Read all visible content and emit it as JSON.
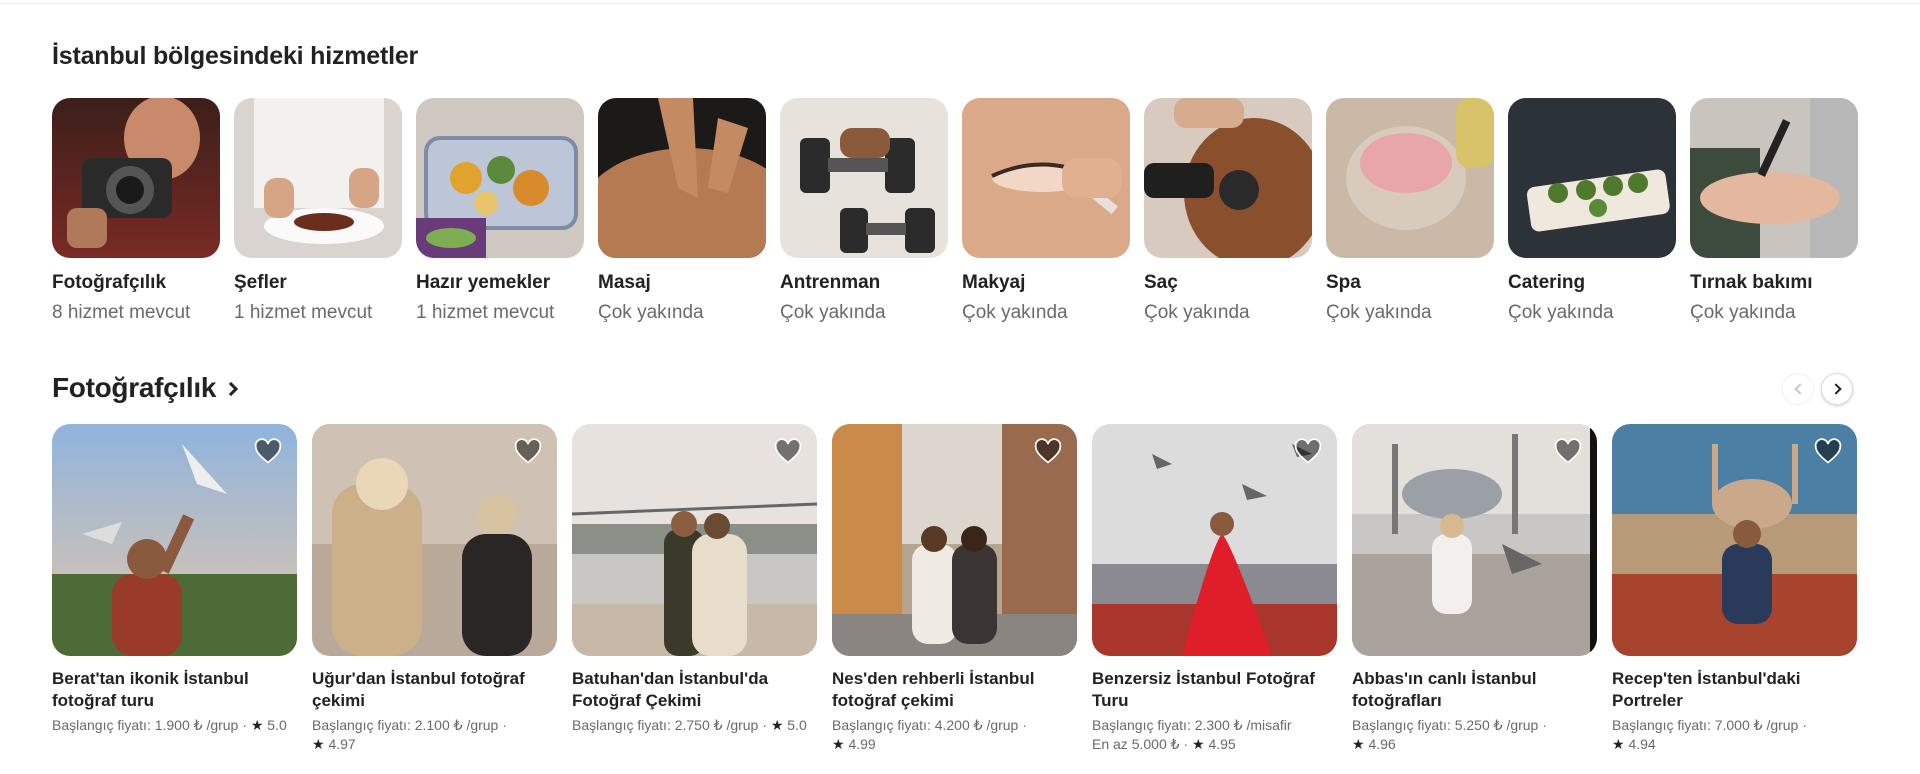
{
  "services": {
    "title": "İstanbul bölgesindeki hizmetler",
    "categories": [
      {
        "name": "Fotoğrafçılık",
        "sub": "8 hizmet mevcut"
      },
      {
        "name": "Şefler",
        "sub": "1 hizmet mevcut"
      },
      {
        "name": "Hazır yemekler",
        "sub": "1 hizmet mevcut"
      },
      {
        "name": "Masaj",
        "sub": "Çok yakında"
      },
      {
        "name": "Antrenman",
        "sub": "Çok yakında"
      },
      {
        "name": "Makyaj",
        "sub": "Çok yakında"
      },
      {
        "name": "Saç",
        "sub": "Çok yakında"
      },
      {
        "name": "Spa",
        "sub": "Çok yakında"
      },
      {
        "name": "Catering",
        "sub": "Çok yakında"
      },
      {
        "name": "Tırnak bakımı",
        "sub": "Çok yakında"
      }
    ]
  },
  "photography": {
    "title": "Fotoğrafçılık",
    "listings": [
      {
        "title": "Berat'tan ikonik İstanbul fotoğraf turu",
        "price": "Başlangıç fiyatı: 1.900 ₺ /grup",
        "extra": "",
        "rating": "5.0"
      },
      {
        "title": "Uğur'dan İstanbul fotoğraf çekimi",
        "price": "Başlangıç fiyatı: 2.100 ₺ /grup",
        "extra": "",
        "rating": "4.97"
      },
      {
        "title": "Batuhan'dan İstanbul'da Fotoğraf Çekimi",
        "price": "Başlangıç fiyatı: 2.750 ₺ /grup",
        "extra": "",
        "rating": "5.0"
      },
      {
        "title": "Nes'den rehberli İstanbul fotoğraf çekimi",
        "price": "Başlangıç fiyatı: 4.200 ₺ /grup",
        "extra": "",
        "rating": "4.99"
      },
      {
        "title": "Benzersiz İstanbul Fotoğraf Turu",
        "price": "Başlangıç fiyatı: 2.300 ₺ /misafir",
        "extra": "En az 5.000 ₺",
        "rating": "4.95"
      },
      {
        "title": "Abbas'ın canlı İstanbul fotoğrafları",
        "price": "Başlangıç fiyatı: 5.250 ₺ /grup",
        "extra": "",
        "rating": "4.96"
      },
      {
        "title": "Recep'ten İstanbul'daki Portreler",
        "price": "Başlangıç fiyatı: 7.000 ₺ /grup",
        "extra": "",
        "rating": "4.94"
      }
    ]
  },
  "icons": {
    "heart": "heart-icon",
    "star": "star-icon",
    "chevron_right": "chevron-right-icon",
    "chevron_left": "chevron-left-icon"
  }
}
